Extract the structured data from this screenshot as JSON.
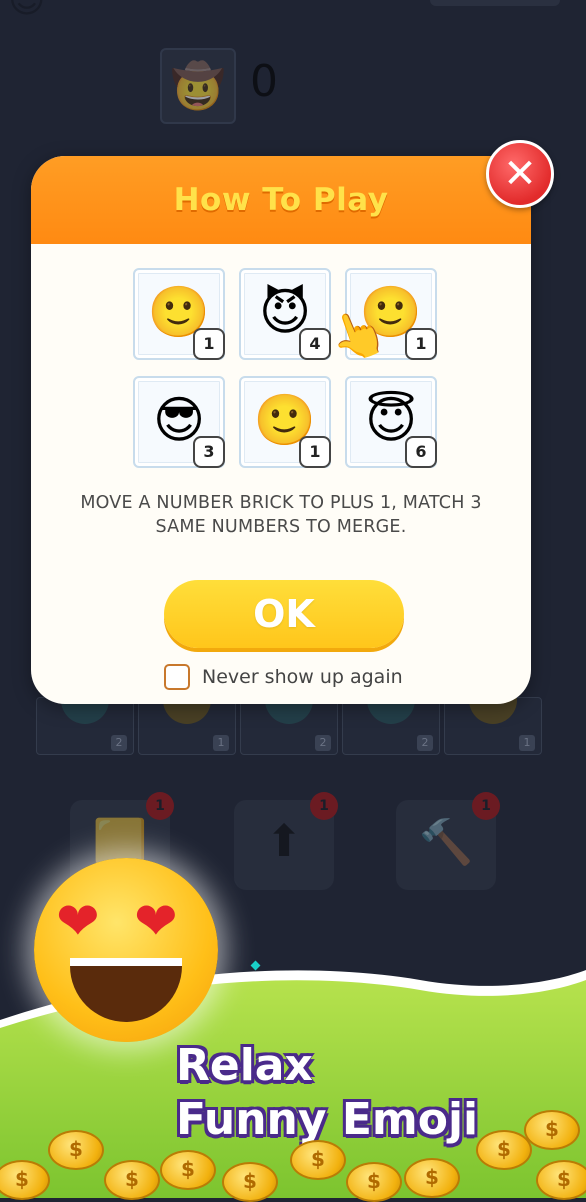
{
  "background": {
    "score": "0",
    "score_icon": "cowboy-emoji",
    "board_counts": [
      "2",
      "1",
      "2",
      "2",
      "1"
    ],
    "booster_badges": [
      "1",
      "1",
      "1"
    ]
  },
  "dialog": {
    "title": "How To Play",
    "close_label": "✕",
    "tiles": [
      {
        "emoji": "🙂",
        "number": "1"
      },
      {
        "emoji": "😈",
        "number": "4"
      },
      {
        "emoji": "🙂",
        "number": "1"
      },
      {
        "emoji": "😎",
        "number": "3"
      },
      {
        "emoji": "🙂",
        "number": "1"
      },
      {
        "emoji": "😇",
        "number": "6"
      }
    ],
    "instructions": "MOVE A NUMBER BRICK TO PLUS 1, MATCH 3 SAME NUMBERS TO MERGE.",
    "ok_label": "OK",
    "never_show_label": "Never show up again",
    "never_show_checked": false
  },
  "promo": {
    "line1": "Relax",
    "line2": "Funny Emoji",
    "coin_symbol": "$"
  },
  "colors": {
    "header_orange": "#ff8a12",
    "title_yellow": "#ffe24a",
    "ok_yellow": "#ffc61b",
    "close_red": "#e22b2b",
    "promo_green": "#8fd13a"
  }
}
